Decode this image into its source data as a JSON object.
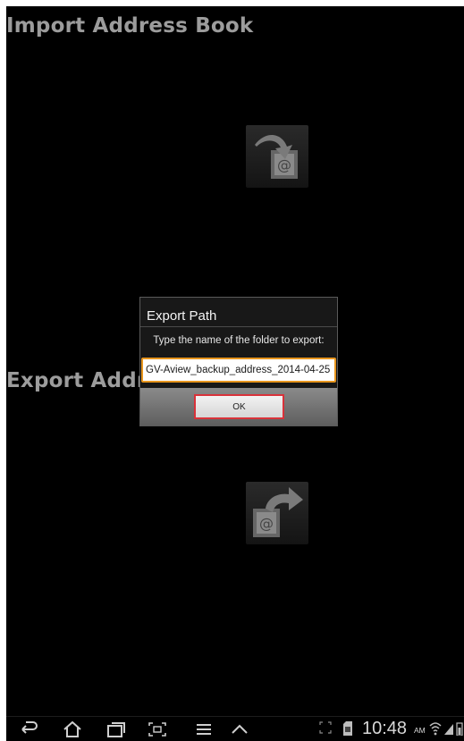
{
  "screen": {
    "import_title": "Import Address Book",
    "export_title": "Export Addre",
    "import_icon": "contact-import-icon",
    "export_icon": "contact-export-icon"
  },
  "dialog": {
    "title": "Export Path",
    "message": "Type the name of the folder to export:",
    "folder_value": "GV-Aview_backup_address_2014-04-25",
    "ok_label": "OK"
  },
  "navbar": {
    "back_icon": "back-icon",
    "home_icon": "home-icon",
    "recent_icon": "recent-apps-icon",
    "screenshot_icon": "screen-capture-icon",
    "menu_icon": "menu-icon",
    "up_icon": "chevron-up-icon",
    "time": "10:48",
    "ampm": "AM"
  },
  "colors": {
    "background": "#000000",
    "title_text": "#9c9c9c",
    "input_focus_border": "#e8961e",
    "button_highlight": "#d8323a"
  }
}
